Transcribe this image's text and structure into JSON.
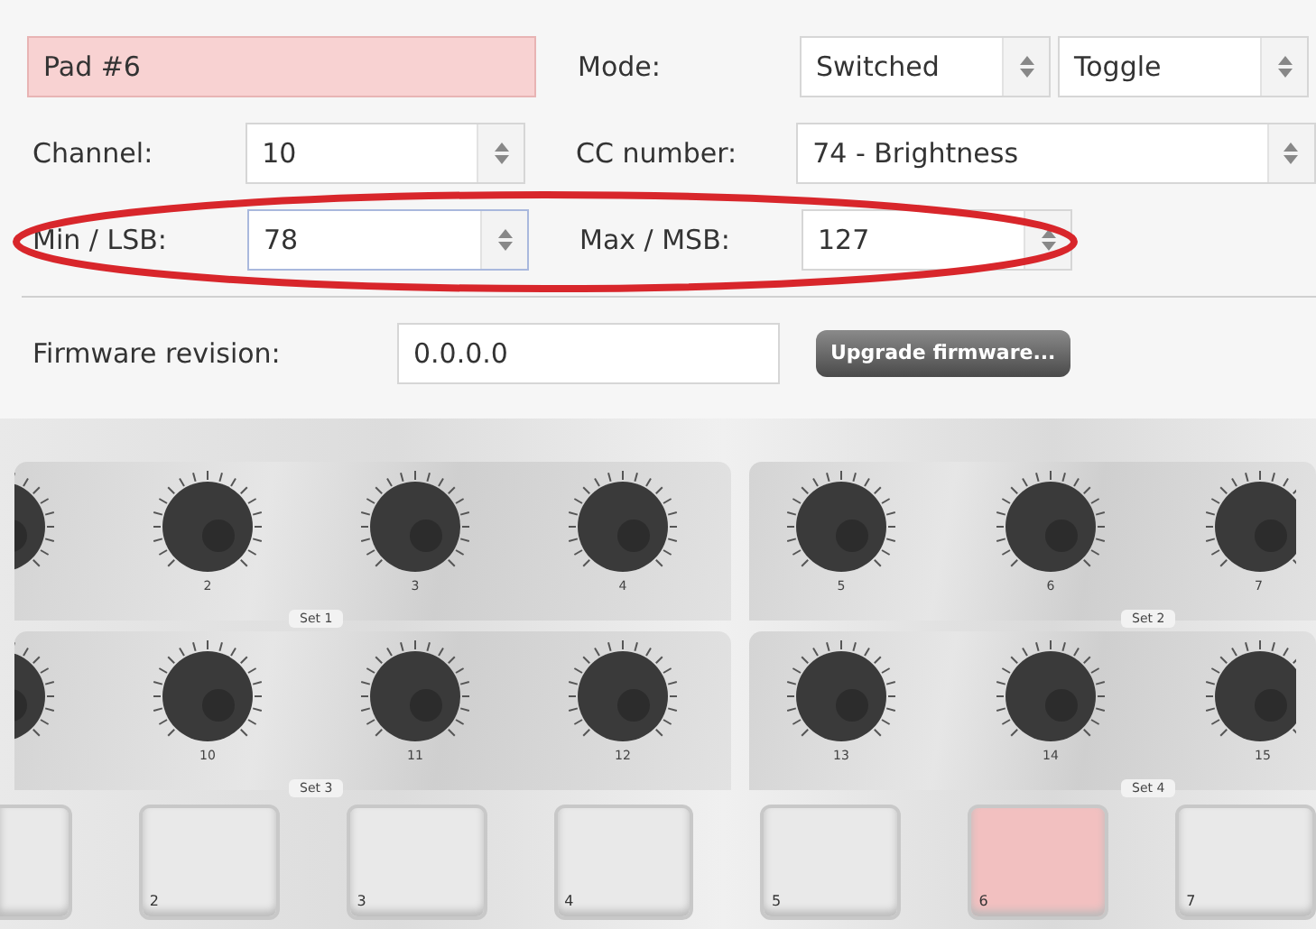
{
  "form": {
    "pad_name": {
      "value": "Pad #6",
      "highlighted": true
    },
    "mode": {
      "label": "Mode:",
      "values": [
        "Switched",
        "Toggle"
      ]
    },
    "channel": {
      "label": "Channel:",
      "value": "10",
      "focused": false
    },
    "cc_number": {
      "label": "CC number:",
      "value": "74 - Brightness"
    },
    "min_lsb": {
      "label": "Min / LSB:",
      "value": "78",
      "focused": true
    },
    "max_msb": {
      "label": "Max / MSB:",
      "value": "127",
      "focused": false
    },
    "min_max_circled": true,
    "firmware": {
      "label": "Firmware revision:",
      "value": "0.0.0.0",
      "button": "Upgrade firmware..."
    }
  },
  "device": {
    "knob_rows": [
      {
        "banks": [
          {
            "set": "Set 1",
            "knobs": [
              "2",
              "3",
              "4"
            ]
          },
          {
            "set": "Set 2",
            "knobs": [
              "5",
              "6",
              "7"
            ]
          }
        ]
      },
      {
        "banks": [
          {
            "set": "Set 3",
            "knobs": [
              "10",
              "11",
              "12"
            ]
          },
          {
            "set": "Set 4",
            "knobs": [
              "13",
              "14",
              "15"
            ]
          }
        ]
      }
    ],
    "pads": [
      {
        "selected": false
      },
      {
        "label": "2",
        "selected": false
      },
      {
        "label": "3",
        "selected": false
      },
      {
        "label": "4",
        "selected": false
      },
      {
        "label": "5",
        "selected": false
      },
      {
        "label": "6",
        "selected": true
      },
      {
        "label": "7",
        "selected": false
      }
    ]
  }
}
